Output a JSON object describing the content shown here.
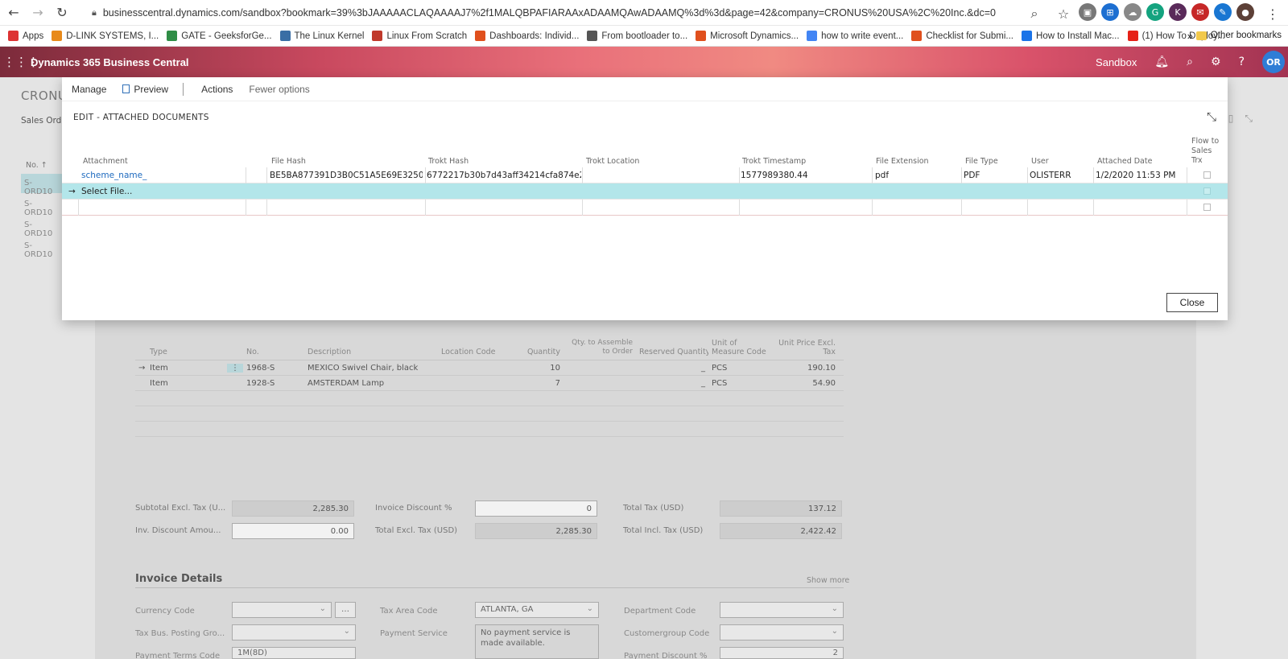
{
  "browser": {
    "url": "businesscentral.dynamics.com/sandbox?bookmark=39%3bJAAAAACLAQAAAAJ7%2f1MALQBPAFIARAAxADAAMQAwADAAMQ%3d%3d&page=42&company=CRONUS%20USA%2C%20Inc.&dc=0",
    "bookmarks": [
      "Apps",
      "D-LINK SYSTEMS, I...",
      "GATE - GeeksforGe...",
      "The Linux Kernel",
      "Linux From Scratch",
      "Dashboards: Individ...",
      "From bootloader to...",
      "Microsoft Dynamics...",
      "how to write event...",
      "Checklist for Submi...",
      "How to Install Mac...",
      "(1) How To Deploy..."
    ],
    "bookmarks_more": "»",
    "other_bookmarks": "Other bookmarks"
  },
  "app": {
    "brand": "Dynamics 365 Business Central",
    "environment": "Sandbox",
    "avatar_initials": "OR"
  },
  "background": {
    "page_title": "CRONU",
    "sub_title": "Sales Orde",
    "list_header": "No. ↑",
    "list_items": [
      "S-ORD10",
      "S-ORD10",
      "S-ORD10",
      "S-ORD10"
    ],
    "lines_headers": {
      "type": "Type",
      "no": "No.",
      "description": "Description",
      "location": "Location Code",
      "quantity": "Quantity",
      "assemble": "Qty. to Assemble to Order",
      "reserved": "Reserved Quantity",
      "uom": "Unit of Measure Code",
      "price": "Unit Price Excl. Tax"
    },
    "lines": [
      {
        "arrow": "→",
        "type": "Item",
        "no": "1968-S",
        "description": "MEXICO Swivel Chair, black",
        "quantity": "10",
        "reserved": "_",
        "uom": "PCS",
        "price": "190.10"
      },
      {
        "arrow": "",
        "type": "Item",
        "no": "1928-S",
        "description": "AMSTERDAM Lamp",
        "quantity": "7",
        "reserved": "_",
        "uom": "PCS",
        "price": "54.90"
      }
    ],
    "totals": {
      "subtotal_label": "Subtotal Excl. Tax (U...",
      "subtotal": "2,285.30",
      "inv_disc_pct_label": "Invoice Discount %",
      "inv_disc_pct": "0",
      "total_tax_label": "Total Tax (USD)",
      "total_tax": "137.12",
      "inv_disc_amt_label": "Inv. Discount Amou...",
      "inv_disc_amt": "0.00",
      "total_excl_label": "Total Excl. Tax (USD)",
      "total_excl": "2,285.30",
      "total_incl_label": "Total Incl. Tax (USD)",
      "total_incl": "2,422.42"
    },
    "invoice_details": {
      "title": "Invoice Details",
      "show_more": "Show more",
      "currency_label": "Currency Code",
      "currency": "",
      "tax_area_label": "Tax Area Code",
      "tax_area": "ATLANTA, GA",
      "department_label": "Department Code",
      "department": "",
      "tax_bus_label": "Tax Bus. Posting Gro...",
      "tax_bus": "",
      "payment_service_label": "Payment Service",
      "payment_service": "No payment service is made available.",
      "customergroup_label": "Customergroup Code",
      "customergroup": "",
      "payment_terms_label": "Payment Terms Code",
      "payment_terms": "1M(8D)",
      "payment_discount_label": "Payment Discount %",
      "payment_discount": "2"
    }
  },
  "modal": {
    "menu": {
      "manage": "Manage",
      "preview": "Preview",
      "actions": "Actions",
      "fewer": "Fewer options"
    },
    "title": "EDIT - ATTACHED DOCUMENTS",
    "columns": {
      "attachment": "Attachment",
      "file_hash": "File Hash",
      "trokt_hash": "Trokt Hash",
      "trokt_location": "Trokt Location",
      "trokt_timestamp": "Trokt Timestamp",
      "file_extension": "File Extension",
      "file_type": "File Type",
      "user": "User",
      "attached_date": "Attached Date",
      "flow": "Flow to Sales Trx"
    },
    "rows": [
      {
        "attachment": "scheme_name_",
        "file_hash": "BE5BA877391D3B0C51A5E69E3250E94...",
        "trokt_hash": "6772217b30b7d43aff34214cfa874e258...",
        "trokt_location": "",
        "trokt_timestamp": "1577989380.44",
        "file_extension": "pdf",
        "file_type": "PDF",
        "user": "OLISTERR",
        "attached_date": "1/2/2020 11:53 PM"
      }
    ],
    "select_row": {
      "arrow": "→",
      "label": "Select File..."
    },
    "close": "Close"
  },
  "colors": {
    "accent": "#1f6bbf",
    "selected_row": "#b3e6ea"
  }
}
